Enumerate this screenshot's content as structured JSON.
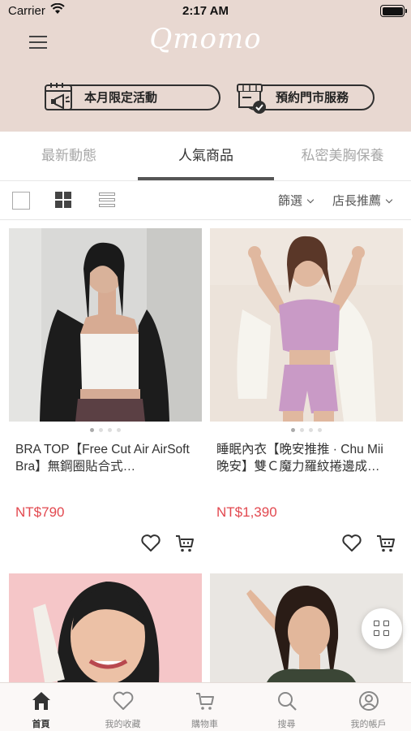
{
  "status_bar": {
    "carrier": "Carrier",
    "time": "2:17 AM"
  },
  "header": {
    "logo": "Qmomo",
    "promo_buttons": [
      {
        "label": "本月限定活動",
        "icon": "calendar-megaphone-icon"
      },
      {
        "label": "預約門市服務",
        "icon": "store-check-icon"
      }
    ]
  },
  "tabs": [
    {
      "label": "最新動態",
      "active": false
    },
    {
      "label": "人氣商品",
      "active": true
    },
    {
      "label": "私密美胸保養",
      "active": false
    }
  ],
  "toolbar": {
    "view_modes": [
      "single-view-icon",
      "grid-view-icon",
      "list-view-icon"
    ],
    "active_view": "grid",
    "filter_label": "篩選",
    "sort_label": "店長推薦"
  },
  "products": [
    {
      "name": "BRA TOP【Free Cut Air AirSoft Bra】無鋼圈貼合式…",
      "price": "NT$790",
      "image_count": 4,
      "active_image": 0
    },
    {
      "name": "睡眠內衣【晚安推推 · Chu Mii 晚安】雙Ｃ魔力羅紋捲邊成…",
      "price": "NT$1,390",
      "image_count": 4,
      "active_image": 0
    }
  ],
  "bottom_nav": [
    {
      "label": "首頁",
      "icon": "home-icon",
      "active": true
    },
    {
      "label": "我的收藏",
      "icon": "heart-icon",
      "active": false
    },
    {
      "label": "購物車",
      "icon": "cart-icon",
      "active": false
    },
    {
      "label": "搜尋",
      "icon": "search-icon",
      "active": false
    },
    {
      "label": "我的帳戶",
      "icon": "account-icon",
      "active": false
    }
  ],
  "colors": {
    "header_bg": "#e8d8d1",
    "price": "#e2484f",
    "active_tab": "#333333",
    "inactive_tab": "#a8a8a8"
  }
}
